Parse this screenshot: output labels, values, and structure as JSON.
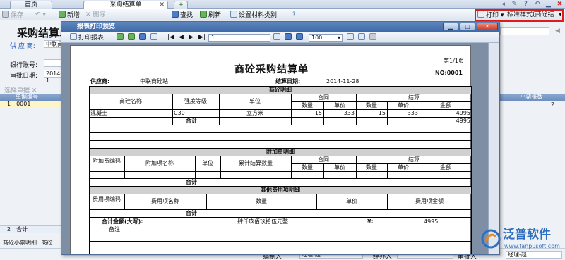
{
  "tabs": [
    {
      "label": "首页",
      "active": false
    },
    {
      "label": "采购结算单",
      "active": true
    }
  ],
  "toolbar": {
    "save": "保存",
    "new": "新增",
    "delete": "删除",
    "find": "查找",
    "refresh": "刷新",
    "set_category": "设置材料类别",
    "print": "打印",
    "print_style": "标准样式(商砼结"
  },
  "form": {
    "title": "采购结算单",
    "supplier_label": "供 应 商:",
    "supplier_value": "中联商",
    "bank_label": "银行账号:",
    "approve_label": "审批日期:",
    "approve_value": "2014-1",
    "select_label": "选择单据",
    "grid_header_no": "单据编号",
    "grid_row_idx": "1",
    "grid_row_no": "0001",
    "right_col_header": "小票张数",
    "right_col_value": "2",
    "sum_idx": "2",
    "sum_label": "合计",
    "bottom_tab1": "商砼小票明细",
    "bottom_tab2": "商砼",
    "footer_editor_label": "编制人",
    "footer_editor_value": "经理-赵",
    "footer_handler_label": "经办人",
    "footer_approver_label": "审批人",
    "footer_approver_value": "经理-赵"
  },
  "dialog": {
    "title": "报表打印预览",
    "print_report": "打印报表",
    "page_input": "1",
    "zoom_value": "100"
  },
  "report": {
    "page_info": "第1/1页",
    "title": "商砼采购结算单",
    "number": "NO:0001",
    "supplier_label": "供应商:",
    "supplier_value": "中联商砼站",
    "date_label": "结算日期:",
    "date_value": "2014-11-28",
    "sec1_title": "商砼明细",
    "h_name": "商砼名称",
    "h_grade": "强度等级",
    "h_unit": "单位",
    "h_contract": "合同",
    "h_settle": "结算",
    "h_qty": "数量",
    "h_price": "单价",
    "h_amount": "金额",
    "row": {
      "name": "混凝土",
      "grade": "C30",
      "unit": "立方米",
      "c_qty": "15",
      "c_price": "333",
      "s_qty": "15",
      "s_price": "333",
      "amount": "4995"
    },
    "subtotal": "合计",
    "subtotal_amount": "4995",
    "sec2_title": "附加费明细",
    "h_fee_code": "附加费编码",
    "h_fee_name": "附加项名称",
    "h_fee_unit": "单位",
    "h_fee_qty": "累计结算数量",
    "sec3_title": "其他费用项明细",
    "h_cost_code": "费用项编码",
    "h_cost_name": "费用项名称",
    "h_cost_qty": "数量",
    "h_cost_price": "单价",
    "h_cost_amount": "费用项金额",
    "total_label": "合计金额(大写):",
    "total_words": "肆仟玖佰玖拾伍元整",
    "yen": "¥:",
    "total_number": "4995",
    "remark": "备注"
  },
  "logo": {
    "name": "泛普软件",
    "url": "www.fanpusoft.com"
  }
}
